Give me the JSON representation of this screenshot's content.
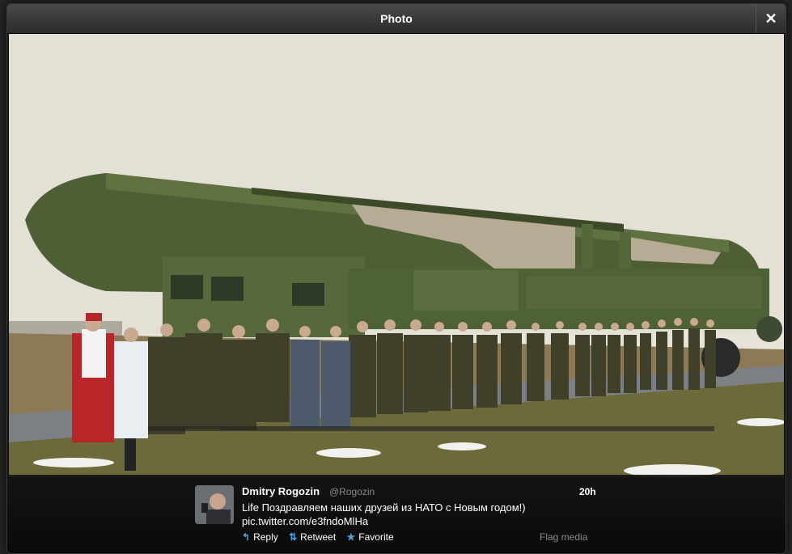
{
  "modal": {
    "title": "Photo",
    "close_label": "✕"
  },
  "photo": {
    "description": "image"
  },
  "tweet": {
    "author_name": "Dmitry Rogozin",
    "author_handle": "@Rogozin",
    "timestamp": "20h",
    "text_line1": "Life Поздравляем наших друзей из НАТО с Новым годом!)",
    "text_line2": "pic.twitter.com/e3fndoMlHa",
    "actions": {
      "reply": "Reply",
      "retweet": "Retweet",
      "favorite": "Favorite"
    },
    "flag_label": "Flag media"
  },
  "colors": {
    "accent": "#4aa3df",
    "header_bg": "#3a3a3a",
    "missile_green": "#4e5f35",
    "uniform_green": "#4a4a30"
  }
}
